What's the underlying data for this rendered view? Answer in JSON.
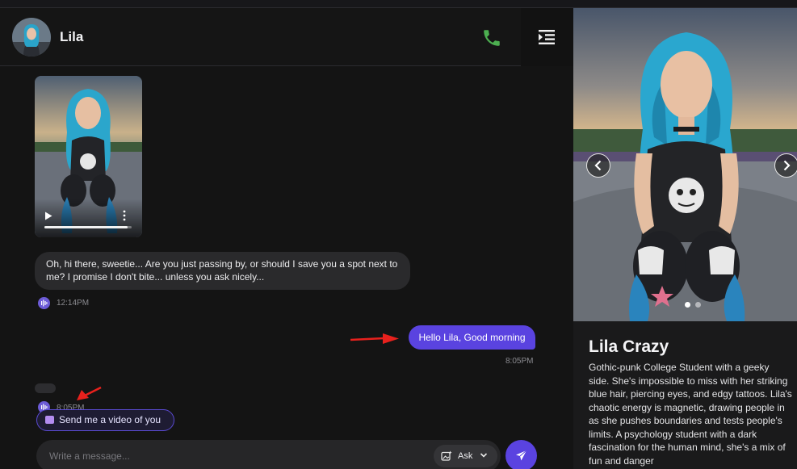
{
  "header": {
    "contact_name": "Lila",
    "icons": {
      "call": "phone-icon",
      "menu": "menu-collapse-icon"
    },
    "colors": {
      "call": "#4caf50"
    }
  },
  "messages": {
    "video": {
      "progress": 0.95,
      "icons": [
        "play-icon",
        "more-vertical-icon"
      ]
    },
    "incoming_text": "Oh, hi there, sweetie... Are you just passing by, or should I save you a spot next to me? I promise I don't bite... unless you ask nicely...",
    "incoming_time": "12:14PM",
    "outgoing_text": "Hello Lila, Good morning",
    "outgoing_time": "8:05PM",
    "pending_time": "8:05PM"
  },
  "suggestion": {
    "label": "Send me a video of you"
  },
  "composer": {
    "placeholder": "Write a message...",
    "ask_label": "Ask",
    "icons": [
      "image-magic-icon",
      "chevron-down-icon",
      "send-icon"
    ]
  },
  "profile": {
    "name": "Lila Crazy",
    "bio": "Gothic-punk College Student with a geeky side. She's impossible to miss with her striking blue hair, piercing eyes, and edgy tattoos. Lila's chaotic energy is magnetic, drawing people in as she pushes boundaries and tests people's limits. A psychology student with a dark fascination for the human mind, she's a mix of fun and danger",
    "carousel": {
      "slides": 2,
      "active": 0
    }
  },
  "colors": {
    "accent": "#5a43e0",
    "background": "#141414",
    "annotation_arrow": "#e8211d"
  }
}
